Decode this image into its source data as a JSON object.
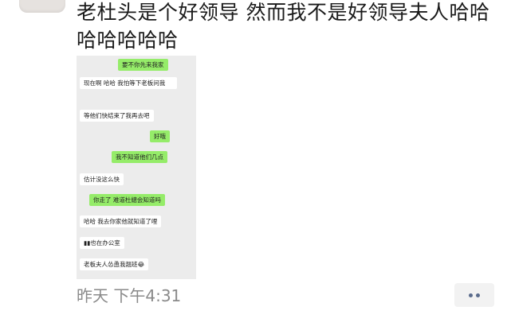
{
  "post": {
    "text": "老杜头是个好领导 然而我不是好领导夫人哈哈哈哈哈哈哈",
    "timestamp": "昨天 下午4:31"
  },
  "chat": {
    "messages": [
      {
        "side": "me",
        "text": "要不你先来我家"
      },
      {
        "side": "other",
        "text": "现在啊 哈哈 我怕等下老板问我"
      },
      {
        "side": "other",
        "text": "等他们快结束了我再去吧"
      },
      {
        "side": "me",
        "text": "好哦"
      },
      {
        "side": "me",
        "text": "我不知道他们几点"
      },
      {
        "side": "other",
        "text": "估计没这么快"
      },
      {
        "side": "me",
        "text": "你走了 难道杜總会知道吗"
      },
      {
        "side": "other",
        "text": "哈哈 我去你家他就知道了哩"
      },
      {
        "side": "other",
        "text": "▮▮也在办公室"
      },
      {
        "side": "other",
        "text": "老板夫人怂恿我翘班😂"
      }
    ]
  },
  "actions": {
    "more_icon": "more-dots-icon"
  },
  "colors": {
    "me_bubble": "#95ec69",
    "other_bubble": "#ffffff",
    "link_dots": "#5a6b8c"
  }
}
